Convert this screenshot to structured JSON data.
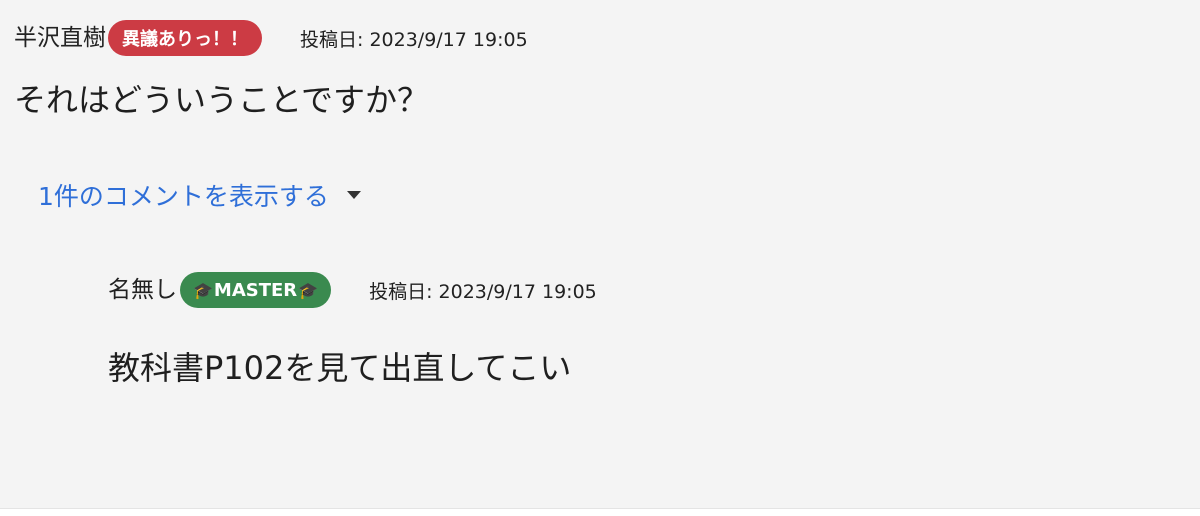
{
  "post": {
    "author": "半沢直樹",
    "badge": "異議ありっ！！",
    "date": "投稿日: 2023/9/17 19:05",
    "body": "それはどういうことですか？"
  },
  "comments_toggle": {
    "label": "1件のコメントを表示する",
    "icon": "caret-down-icon"
  },
  "reply": {
    "author": "名無し",
    "badge_icon": "🎓",
    "badge": "MASTER",
    "date": "投稿日: 2023/9/17 19:05",
    "body": "教科書P102を見て出直してこい"
  },
  "colors": {
    "background": "#f4f4f4",
    "objection_badge": "#cc3b44",
    "master_badge": "#3a8a4f",
    "link": "#2f6fd8"
  }
}
